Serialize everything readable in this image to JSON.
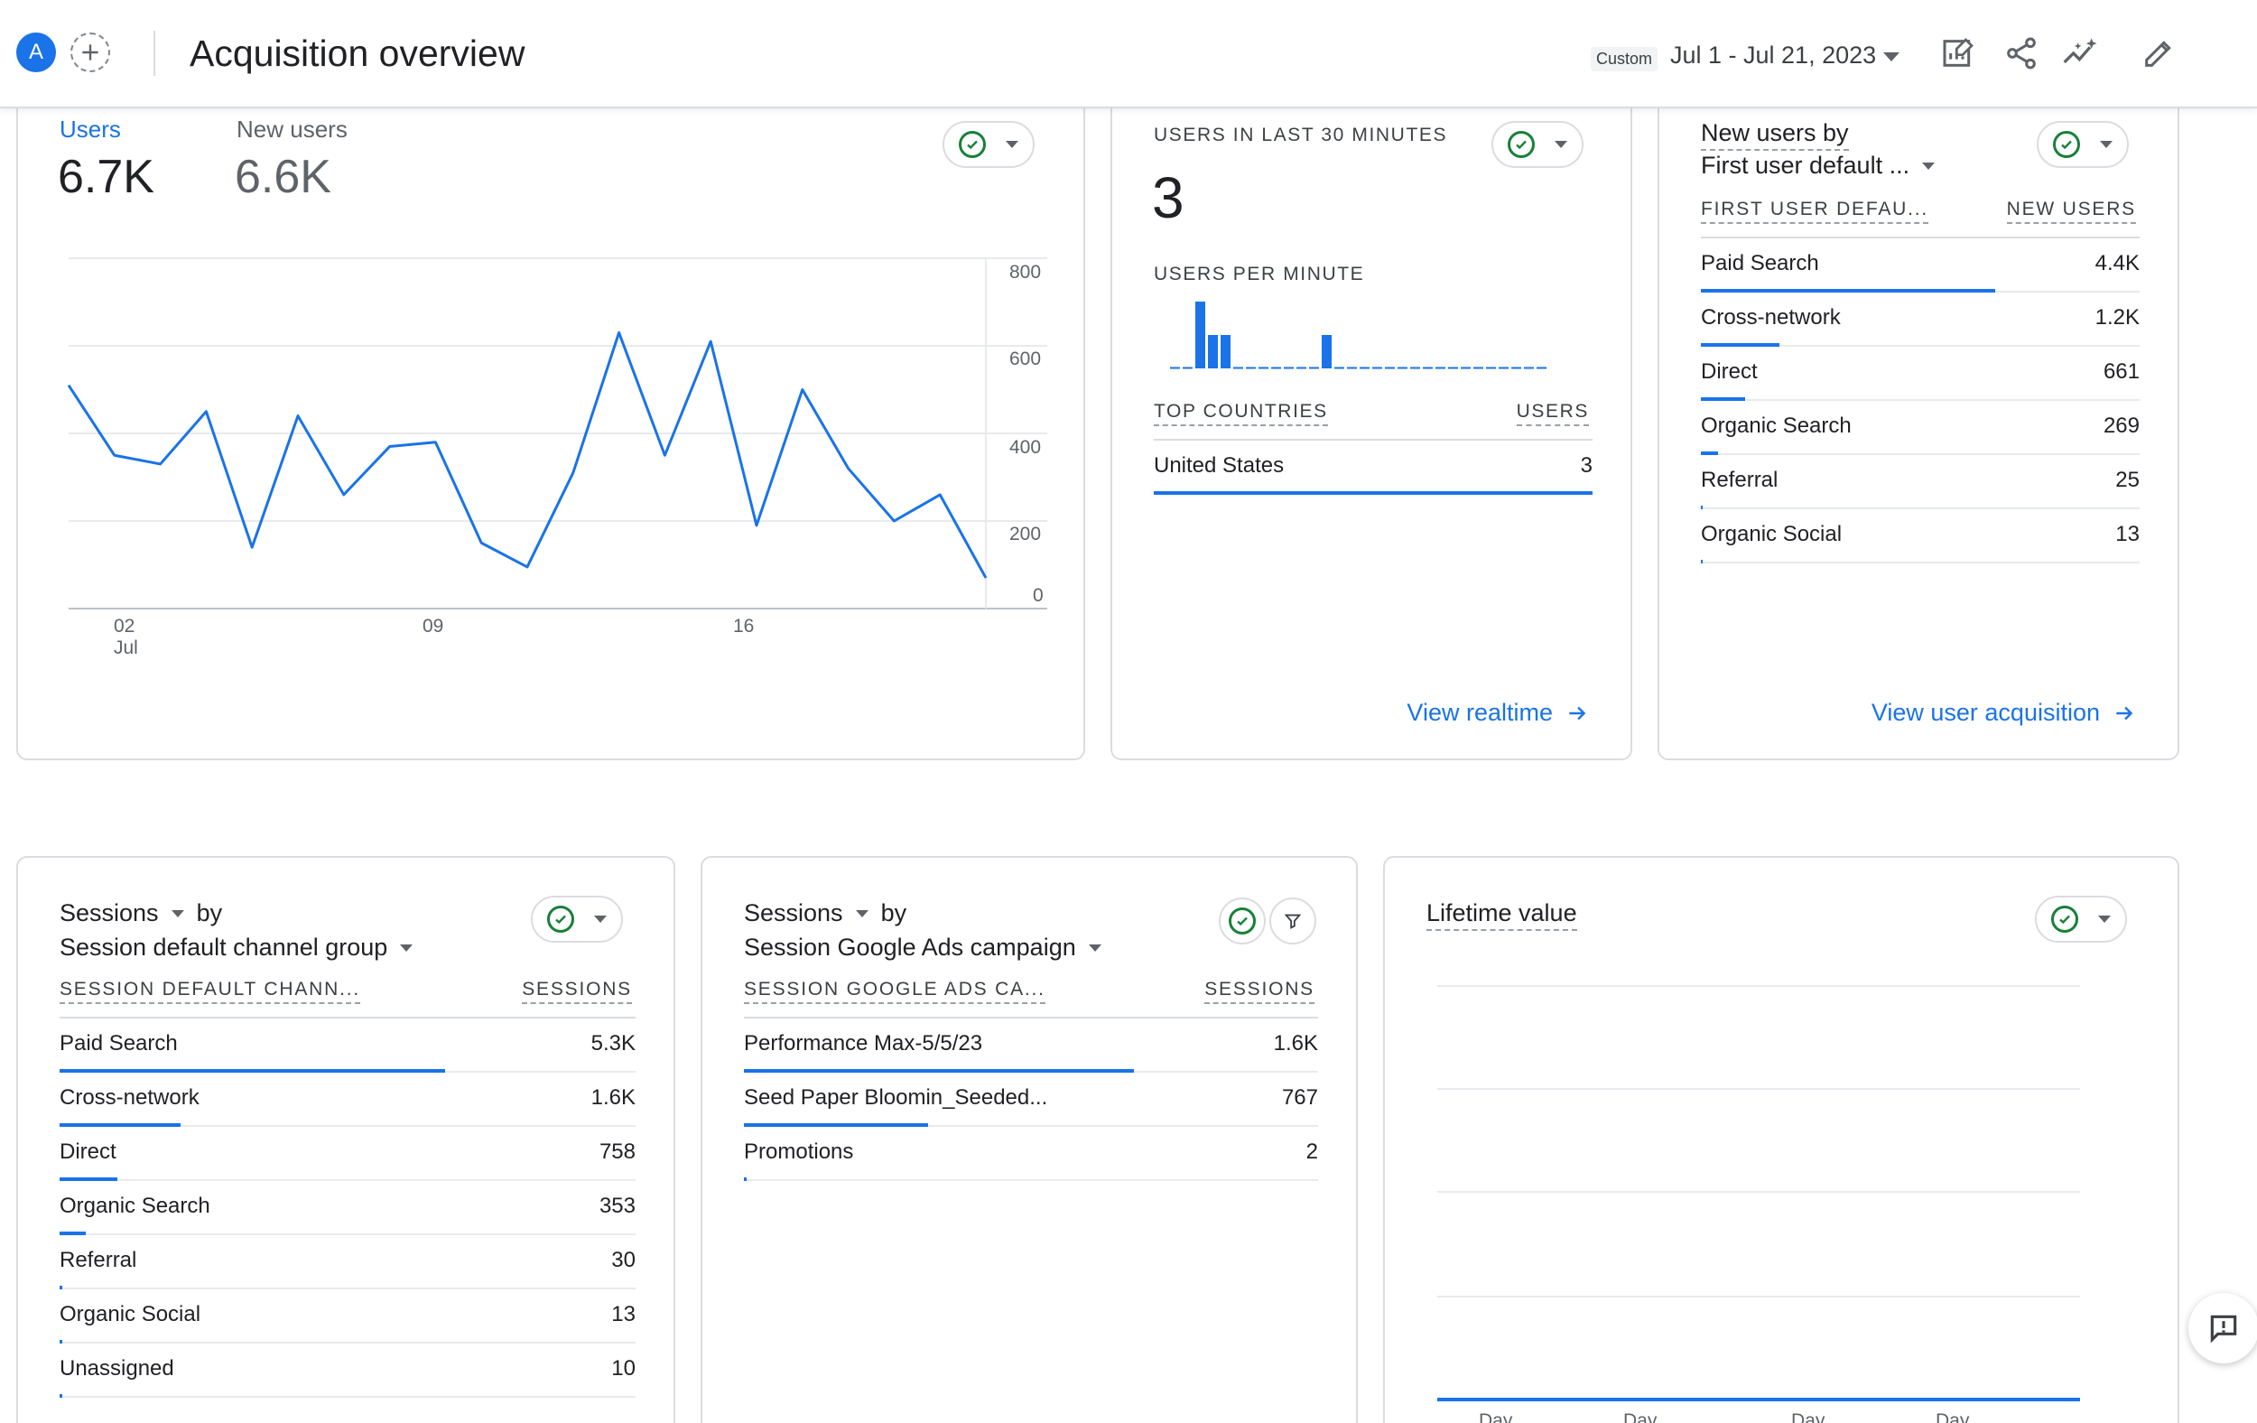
{
  "header": {
    "avatar_letter": "A",
    "title": "Acquisition overview",
    "date_badge": "Custom",
    "date_range": "Jul 1 - Jul 21, 2023"
  },
  "users_card": {
    "tab_users": "Users",
    "tab_users_value": "6.7K",
    "tab_new_users": "New users",
    "tab_new_users_value": "6.6K",
    "y_ticks": [
      "800",
      "600",
      "400",
      "200",
      "0"
    ],
    "x_ticks": [
      "02",
      "09",
      "16"
    ],
    "x_month": "Jul"
  },
  "chart_data": {
    "type": "line",
    "title": "",
    "xlabel": "",
    "ylabel": "",
    "ylim": [
      0,
      800
    ],
    "x": [
      "Jul 1",
      "Jul 2",
      "Jul 3",
      "Jul 4",
      "Jul 5",
      "Jul 6",
      "Jul 7",
      "Jul 8",
      "Jul 9",
      "Jul 10",
      "Jul 11",
      "Jul 12",
      "Jul 13",
      "Jul 14",
      "Jul 15",
      "Jul 16",
      "Jul 17",
      "Jul 18",
      "Jul 19",
      "Jul 20",
      "Jul 21"
    ],
    "series": [
      {
        "values": [
          510,
          350,
          330,
          450,
          140,
          440,
          260,
          370,
          380,
          150,
          95,
          310,
          630,
          350,
          610,
          190,
          500,
          320,
          200,
          260,
          70
        ]
      }
    ]
  },
  "realtime": {
    "heading": "USERS IN LAST 30 MINUTES",
    "count": "3",
    "per_minute_label": "USERS PER MINUTE",
    "per_minute_values": [
      0,
      0,
      1,
      0.5,
      0.5,
      0,
      0,
      0,
      0,
      0,
      0,
      0,
      0.5,
      0,
      0,
      0,
      0,
      0,
      0,
      0,
      0,
      0,
      0,
      0,
      0,
      0,
      0,
      0,
      0,
      0
    ],
    "top_countries_label": "TOP COUNTRIES",
    "users_label": "USERS",
    "countries": [
      {
        "name": "United States",
        "value": "3",
        "fraction": 1.0
      }
    ],
    "link": "View realtime"
  },
  "new_users_by": {
    "title_line1": "New users by",
    "title_line2": "First user default ...",
    "col1": "FIRST USER DEFAU...",
    "col2": "NEW USERS",
    "rows": [
      {
        "label": "Paid Search",
        "value": "4.4K",
        "fraction": 0.67
      },
      {
        "label": "Cross-network",
        "value": "1.2K",
        "fraction": 0.18
      },
      {
        "label": "Direct",
        "value": "661",
        "fraction": 0.1
      },
      {
        "label": "Organic Search",
        "value": "269",
        "fraction": 0.04
      },
      {
        "label": "Referral",
        "value": "25",
        "fraction": 0.004
      },
      {
        "label": "Organic Social",
        "value": "13",
        "fraction": 0.002
      }
    ],
    "link": "View user acquisition"
  },
  "sessions_channel": {
    "metric": "Sessions",
    "by": "by",
    "dimension": "Session default channel group",
    "col1": "SESSION DEFAULT CHANN...",
    "col2": "SESSIONS",
    "rows": [
      {
        "label": "Paid Search",
        "value": "5.3K",
        "fraction": 0.67
      },
      {
        "label": "Cross-network",
        "value": "1.6K",
        "fraction": 0.21
      },
      {
        "label": "Direct",
        "value": "758",
        "fraction": 0.1
      },
      {
        "label": "Organic Search",
        "value": "353",
        "fraction": 0.045
      },
      {
        "label": "Referral",
        "value": "30",
        "fraction": 0.004
      },
      {
        "label": "Organic Social",
        "value": "13",
        "fraction": 0.002
      },
      {
        "label": "Unassigned",
        "value": "10",
        "fraction": 0.001
      }
    ]
  },
  "sessions_campaign": {
    "metric": "Sessions",
    "by": "by",
    "dimension": "Session Google Ads campaign",
    "col1": "SESSION GOOGLE ADS CA...",
    "col2": "SESSIONS",
    "rows": [
      {
        "label": "Performance Max-5/5/23",
        "value": "1.6K",
        "fraction": 0.68
      },
      {
        "label": "Seed Paper Bloomin_Seeded...",
        "value": "767",
        "fraction": 0.32
      },
      {
        "label": "Promotions",
        "value": "2",
        "fraction": 0.001
      }
    ]
  },
  "lifetime": {
    "title": "Lifetime value",
    "x_labels": [
      "Day",
      "Day",
      "Day",
      "Day"
    ]
  },
  "colors": {
    "accent": "#1a73e8",
    "check": "#188038",
    "border": "#dadce0"
  },
  "icons": [
    "add-icon",
    "customize-report-icon",
    "share-icon",
    "insights-icon",
    "edit-icon",
    "check-icon",
    "chevron-down-icon",
    "arrow-right-icon",
    "filter-icon",
    "feedback-icon"
  ]
}
